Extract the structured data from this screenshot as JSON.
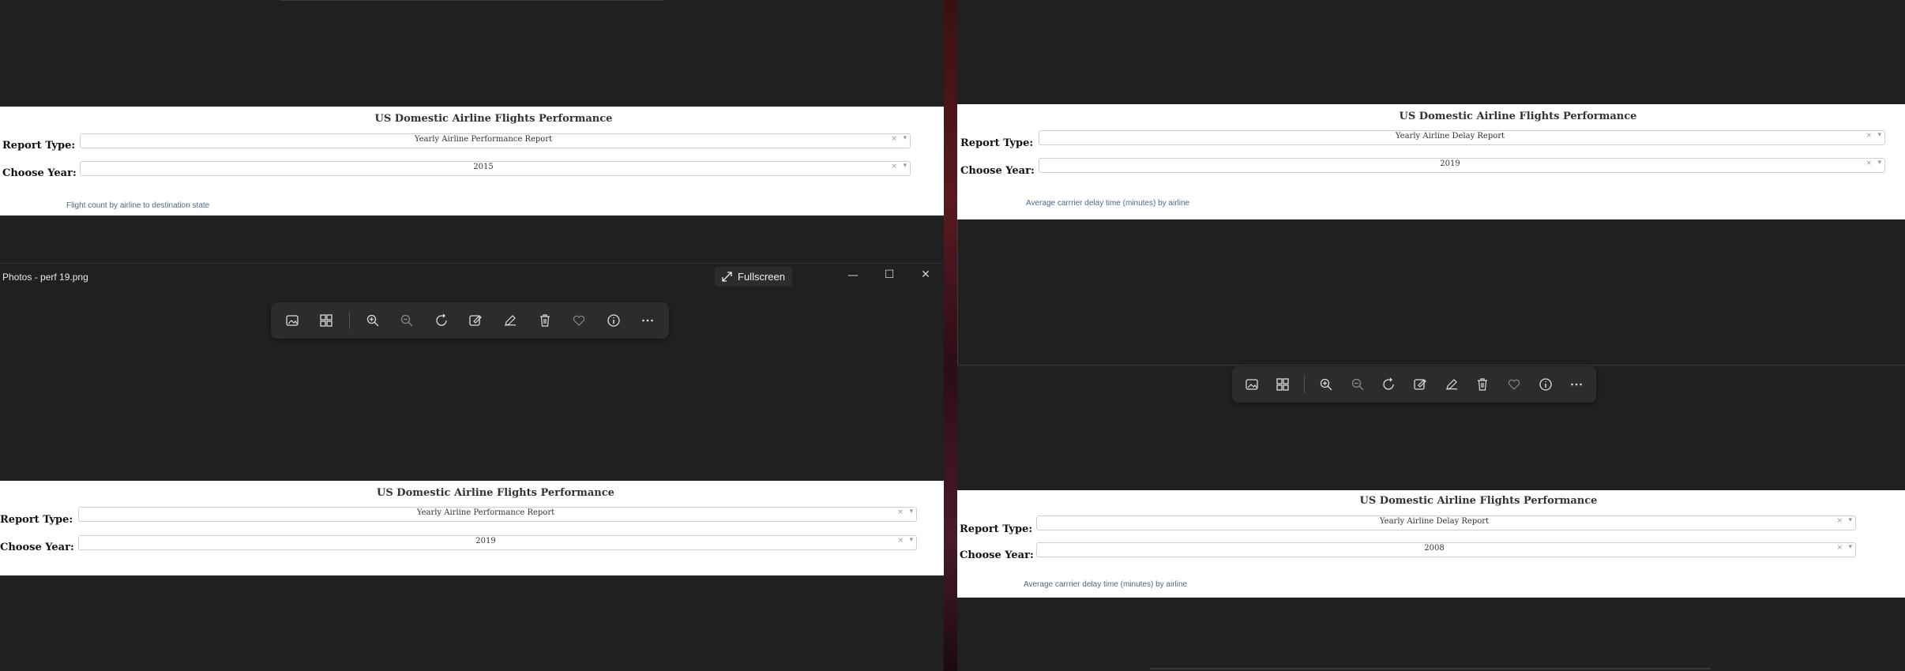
{
  "window": {
    "title": "Photos - perf 19.png",
    "fullscreen_label": "Fullscreen"
  },
  "panels": [
    {
      "title": "US Domestic Airline Flights Performance",
      "report_label": "Report Type:",
      "report_value": "Yearly Airline Performance Report",
      "year_label": "Choose Year:",
      "year_value": "2015",
      "caption": "Flight count by airline to destination state"
    },
    {
      "title": "US Domestic Airline Flights Performance",
      "report_label": "Report Type:",
      "report_value": "Yearly Airline Delay Report",
      "year_label": "Choose Year:",
      "year_value": "2019",
      "caption": "Average carrrier delay time (minutes) by airline"
    },
    {
      "title": "US Domestic Airline Flights Performance",
      "report_label": "Report Type:",
      "report_value": "Yearly Airline Performance Report",
      "year_label": "Choose Year:",
      "year_value": "2019",
      "caption": ""
    },
    {
      "title": "US Domestic Airline Flights Performance",
      "report_label": "Report Type:",
      "report_value": "Yearly Airline Delay Report",
      "year_label": "Choose Year:",
      "year_value": "2008",
      "caption": "Average carrrier delay time (minutes) by airline"
    }
  ],
  "dropdown_clear_glyph": "×",
  "dropdown_caret_glyph": "▾",
  "toolbar_icons": [
    "gallery-icon",
    "collection-icon",
    "zoom-in-icon",
    "zoom-out-icon",
    "rotate-icon",
    "edit-image-icon",
    "draw-icon",
    "delete-icon",
    "favorite-icon",
    "info-icon",
    "more-icon"
  ]
}
